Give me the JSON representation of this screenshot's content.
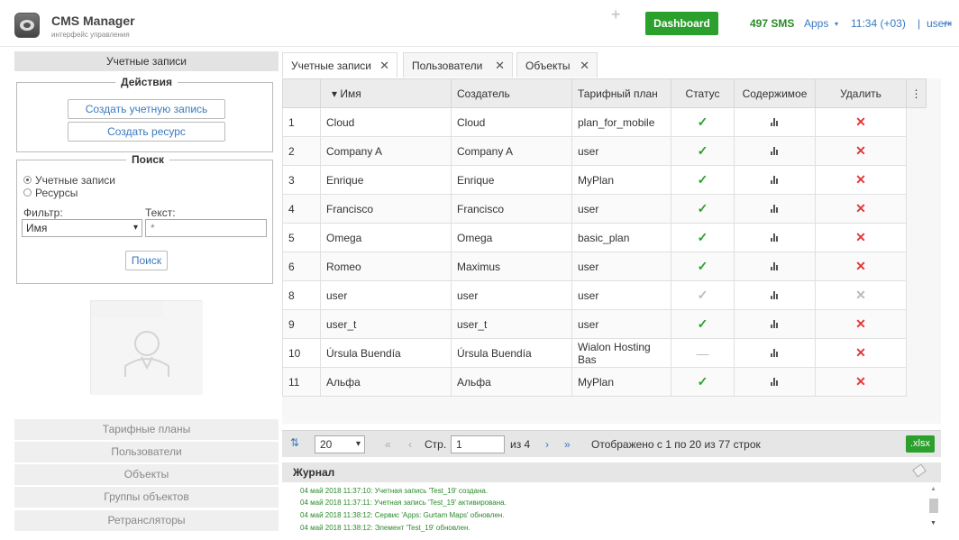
{
  "header": {
    "app_title": "CMS Manager",
    "app_subtitle": "интерфейс управления",
    "dashboard_label": "Dashboard",
    "sms": "497 SMS",
    "apps_label": "Apps",
    "apps_caret": "▾",
    "clock": "11:34 (+03)",
    "separator": "|",
    "username": "user",
    "logout_icon": "⇥"
  },
  "left": {
    "section_title": "Учетные записи",
    "actions_legend": "Действия",
    "create_account": "Создать учетную запись",
    "create_resource": "Создать ресурс",
    "search_legend": "Поиск",
    "radio_accounts": "Учетные записи",
    "radio_resources": "Ресурсы",
    "filter_label": "Фильтр:",
    "text_label": "Текст:",
    "filter_value": "Имя",
    "filter_caret": "▾",
    "text_value": "*",
    "search_button": "Поиск",
    "nav": [
      "Тарифные планы",
      "Пользователи",
      "Объекты",
      "Группы объектов",
      "Ретрансляторы"
    ]
  },
  "tabs": [
    {
      "label": "Учетные записи",
      "close": "✕"
    },
    {
      "label": "Пользователи",
      "close": "✕"
    },
    {
      "label": "Объекты",
      "close": "✕"
    }
  ],
  "tab_add": "+",
  "table": {
    "columns": [
      "",
      "▾ Имя",
      "Создатель",
      "Тарифный план",
      "Статус",
      "Содержимое",
      "Удалить",
      "⋮"
    ],
    "rows": [
      {
        "n": "1",
        "name": "Cloud",
        "creator": "Cloud",
        "plan": "plan_for_mobile",
        "status": "active"
      },
      {
        "n": "2",
        "name": "Company A",
        "creator": "Company A",
        "plan": "user",
        "status": "active"
      },
      {
        "n": "3",
        "name": "Enrique",
        "creator": "Enrique",
        "plan": "MyPlan",
        "status": "active"
      },
      {
        "n": "4",
        "name": "Francisco",
        "creator": "Francisco",
        "plan": "user",
        "status": "active"
      },
      {
        "n": "5",
        "name": "Omega",
        "creator": "Omega",
        "plan": "basic_plan",
        "status": "active"
      },
      {
        "n": "6",
        "name": "Romeo",
        "creator": "Maximus",
        "plan": "user",
        "status": "active"
      },
      {
        "n": "8",
        "name": "user",
        "creator": "user",
        "plan": "user",
        "status": "self"
      },
      {
        "n": "9",
        "name": "user_t",
        "creator": "user_t",
        "plan": "user",
        "status": "active"
      },
      {
        "n": "10",
        "name": "Úrsula Buendía",
        "creator": "Úrsula Buendía",
        "plan": "Wialon Hosting Bas",
        "status": "none"
      },
      {
        "n": "11",
        "name": "Альфа",
        "creator": "Альфа",
        "plan": "MyPlan",
        "status": "active"
      }
    ],
    "check_glyph": "✓",
    "delete_glyph": "✕",
    "none_glyph": "—"
  },
  "pager": {
    "size_icon": "⇅",
    "page_size": "20",
    "first": "«",
    "prev": "‹",
    "page_label": "Стр.",
    "page_value": "1",
    "of": "из 4",
    "next": "›",
    "last": "»",
    "summary": "Отображено с 1 по 20 из 77 строк",
    "export": ".xlsx"
  },
  "journal": {
    "title": "Журнал",
    "lines": [
      "04 май 2018 11:37:10: Учетная запись 'Test_19' создана.",
      "04 май 2018 11:37:11: Учетная запись 'Test_19' активирована.",
      "04 май 2018 11:38:12: Сервис 'Apps: Gurtam Maps' обновлен.",
      "04 май 2018 11:38:12: Элемент 'Test_19' обновлен."
    ],
    "scroll_up": "▲",
    "scroll_down": "▼"
  }
}
